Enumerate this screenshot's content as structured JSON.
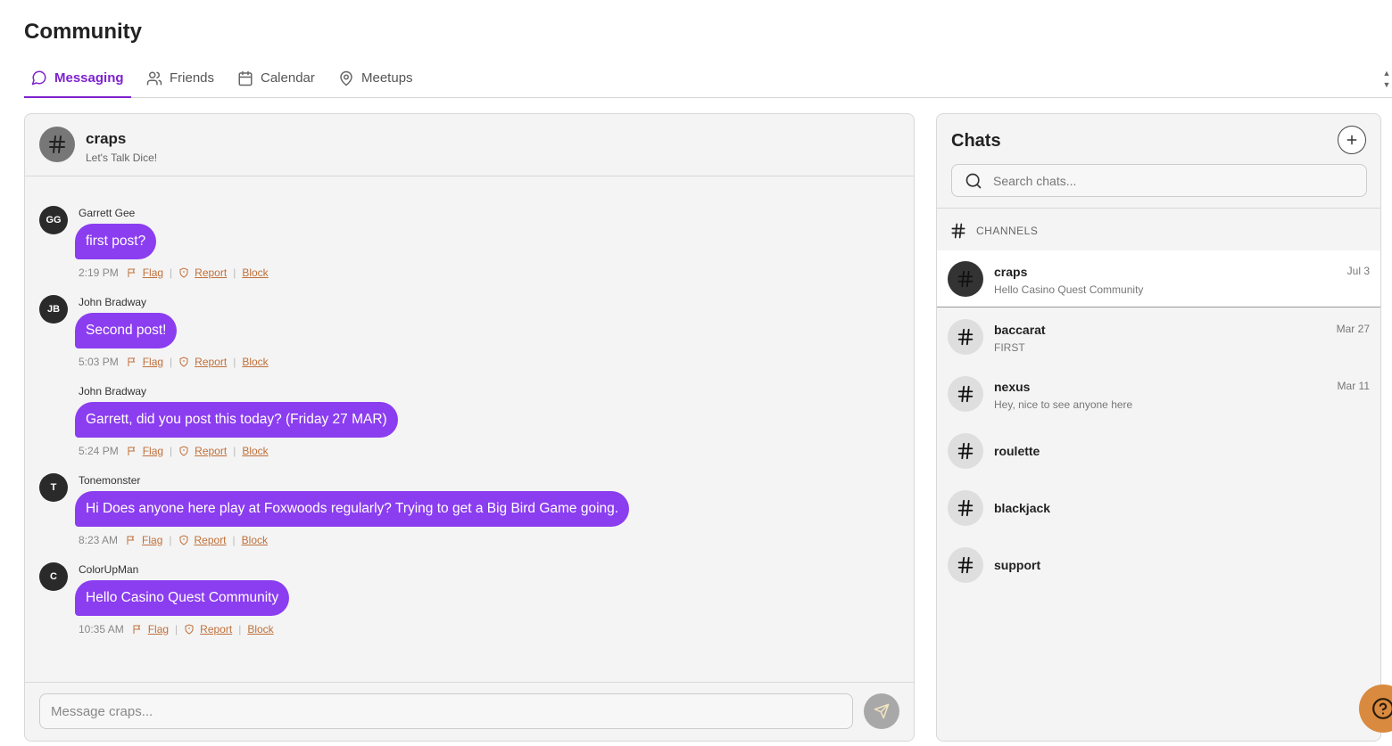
{
  "page": {
    "title": "Community"
  },
  "tabs": [
    {
      "label": "Messaging",
      "icon": "message-circle-icon"
    },
    {
      "label": "Friends",
      "icon": "users-icon"
    },
    {
      "label": "Calendar",
      "icon": "calendar-icon"
    },
    {
      "label": "Meetups",
      "icon": "map-pin-icon"
    }
  ],
  "chat": {
    "channel_name": "craps",
    "channel_description": "Let's Talk Dice!",
    "messages": [
      {
        "initials": "GG",
        "author": "Garrett Gee",
        "text": "first post?",
        "time": "2:19 PM"
      },
      {
        "initials": "JB",
        "author": "John Bradway",
        "text": "Second post!",
        "time": "5:03 PM"
      },
      {
        "initials": "",
        "author": "John Bradway",
        "text": "Garrett, did you post this today? (Friday 27 MAR)",
        "time": "5:24 PM"
      },
      {
        "initials": "T",
        "author": "Tonemonster",
        "text": "Hi Does anyone here play at Foxwoods regularly? Trying to get a Big Bird Game going.",
        "time": "8:23 AM"
      },
      {
        "initials": "C",
        "author": "ColorUpMan",
        "text": "Hello Casino Quest Community",
        "time": "10:35 AM"
      }
    ],
    "actions": {
      "flag": "Flag",
      "report": "Report",
      "block": "Block",
      "separator": "|"
    },
    "composer_placeholder": "Message craps..."
  },
  "chats": {
    "title": "Chats",
    "search_placeholder": "Search chats...",
    "section_label": "CHANNELS",
    "channels": [
      {
        "name": "craps",
        "preview": "Hello Casino Quest Community",
        "date": "Jul 3"
      },
      {
        "name": "baccarat",
        "preview": "FIRST",
        "date": "Mar 27"
      },
      {
        "name": "nexus",
        "preview": "Hey, nice to see anyone here",
        "date": "Mar 11"
      },
      {
        "name": "roulette",
        "preview": "",
        "date": ""
      },
      {
        "name": "blackjack",
        "preview": "",
        "date": ""
      },
      {
        "name": "support",
        "preview": "",
        "date": ""
      }
    ]
  },
  "colors": {
    "accent": "#7e22ce",
    "bubble": "#8b3df0",
    "link": "#c0703a",
    "help_button": "#d98a3e"
  }
}
